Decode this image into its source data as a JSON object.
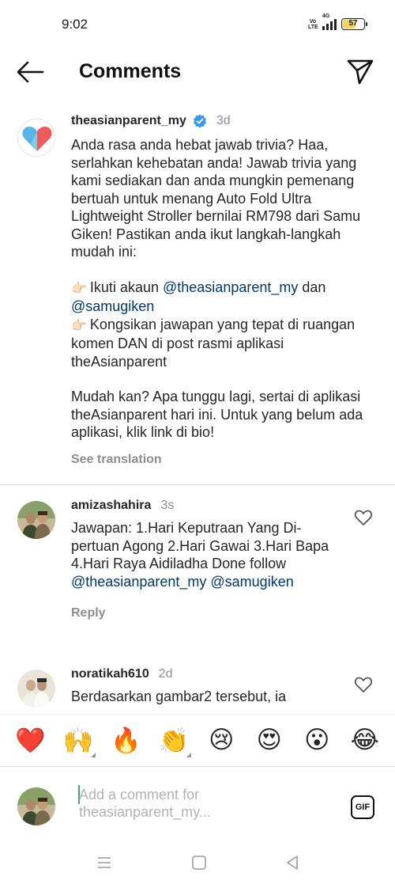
{
  "status_bar": {
    "time": "9:02",
    "network_label": "4G",
    "volte_label": "Vo LTE",
    "battery_level": "57"
  },
  "header": {
    "title": "Comments"
  },
  "caption": {
    "username": "theasianparent_my",
    "time": "3d",
    "line1": "Anda rasa anda hebat jawab trivia? Haa, serlahkan kehebatan anda! Jawab trivia yang kami sediakan dan anda mungkin pemenang bertuah untuk menang Auto Fold Ultra Lightweight Stroller bernilai RM798 dari Samu Giken! Pastikan anda ikut langkah-langkah mudah ini:",
    "step1_pointer": "👉🏻",
    "step1_text": "Ikuti akaun",
    "step1_mention1": "@theasianparent_my",
    "step1_and": "dan",
    "step1_mention2": "@samugiken",
    "step2_pointer": "👉🏻",
    "step2_text": "Kongsikan jawapan yang tepat di ruangan komen DAN di post rasmi aplikasi theAsianparent",
    "line3": "Mudah kan? Apa tunggu lagi, sertai di aplikasi theAsianparent hari ini. Untuk yang belum ada aplikasi, klik link di bio!",
    "see_translation": "See translation"
  },
  "comments": [
    {
      "username": "amizashahira",
      "time": "3s",
      "text": "Jawapan: 1.Hari Keputraan Yang Di-pertuan Agong 2.Hari Gawai 3.Hari Bapa 4.Hari Raya Aidiladha Done follow",
      "mention1": "@theasianparent_my",
      "mention2": "@samugiken",
      "reply": "Reply"
    },
    {
      "username": "noratikah610",
      "time": "2d",
      "text": "Berdasarkan gambar2 tersebut, ia"
    }
  ],
  "emoji_bar": [
    "❤️",
    "🙌",
    "🔥",
    "👏",
    "😢",
    "😍",
    "😮",
    "😂"
  ],
  "comment_input": {
    "placeholder": "Add a comment for theasianparent_my..."
  },
  "gif_label": "GIF",
  "colors": {
    "mention": "#00376b",
    "verified": "#3897f0",
    "secondary_text": "#8e8e8e"
  }
}
